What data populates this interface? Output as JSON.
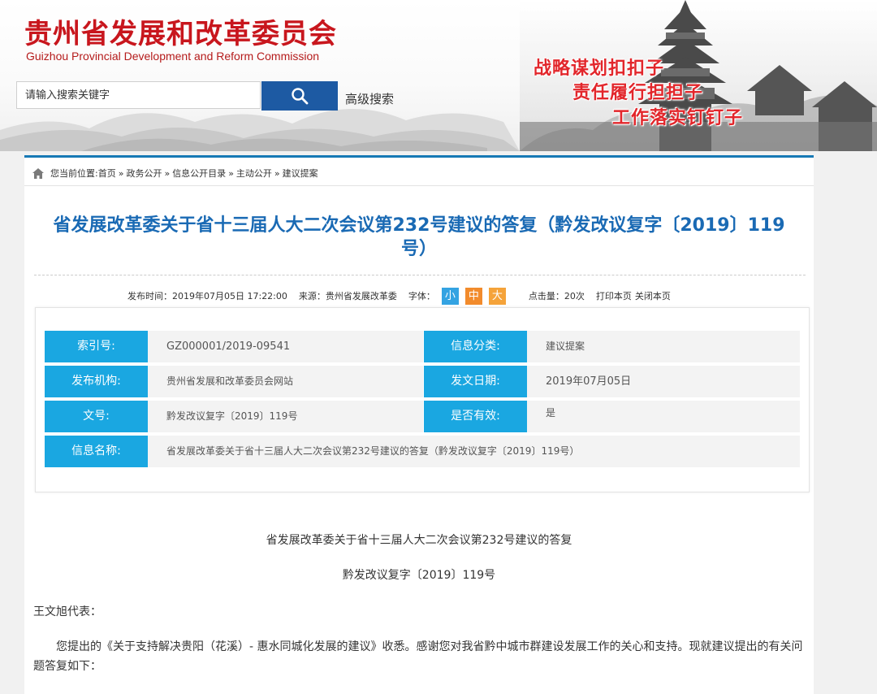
{
  "header": {
    "title_cn": "贵州省发展和改革委员会",
    "title_en": "Guizhou Provincial Development and Reform Commission",
    "search_placeholder": "请输入搜索关键字",
    "advanced_search": "高级搜索",
    "slogans": [
      "战略谋划扣扣子",
      "责任履行担担子",
      "工作落实钉钉子"
    ]
  },
  "breadcrumb": {
    "prefix": "您当前位置:",
    "items": [
      "首页",
      "政务公开",
      "信息公开目录",
      "主动公开",
      "建议提案"
    ],
    "separator": "»"
  },
  "article": {
    "title": "省发展改革委关于省十三届人大二次会议第232号建议的答复（黔发改议复字〔2019〕119号）",
    "meta": {
      "publish_time_label": "发布时间：",
      "publish_time": "2019年07月05日 17:22:00",
      "source_label": "来源：",
      "source": "贵州省发展改革委",
      "font_label": "字体：",
      "font_sizes": [
        "小",
        "中",
        "大"
      ],
      "clicks_label": "点击量：",
      "clicks": "20次",
      "print": "打印本页",
      "close": "关闭本页"
    }
  },
  "info_table": {
    "index_label": "索引号:",
    "index_value": "GZ000001/2019-09541",
    "category_label": "信息分类:",
    "category_value": "建议提案",
    "publisher_label": "发布机构:",
    "publisher_value": "贵州省发展和改革委员会网站",
    "date_label": "发文日期:",
    "date_value": "2019年07月05日",
    "doc_no_label": "文号:",
    "doc_no_value": "黔发改议复字〔2019〕119号",
    "valid_label": "是否有效:",
    "valid_value": "是",
    "name_label": "信息名称:",
    "name_value": "省发展改革委关于省十三届人大二次会议第232号建议的答复（黔发改议复字〔2019〕119号）"
  },
  "body": {
    "heading": "省发展改革委关于省十三届人大二次会议第232号建议的答复",
    "doc_number": "黔发改议复字〔2019〕119号",
    "salutation": "王文旭代表：",
    "paragraph": "您提出的《关于支持解决贵阳（花溪）- 惠水同城化发展的建议》收悉。感谢您对我省黔中城市群建设发展工作的关心和支持。现就建议提出的有关问题答复如下："
  },
  "colors": {
    "brand_red": "#c8161d",
    "title_blue": "#1a6ab4",
    "label_blue": "#1aa7e1",
    "search_blue": "#1d5aa3"
  }
}
